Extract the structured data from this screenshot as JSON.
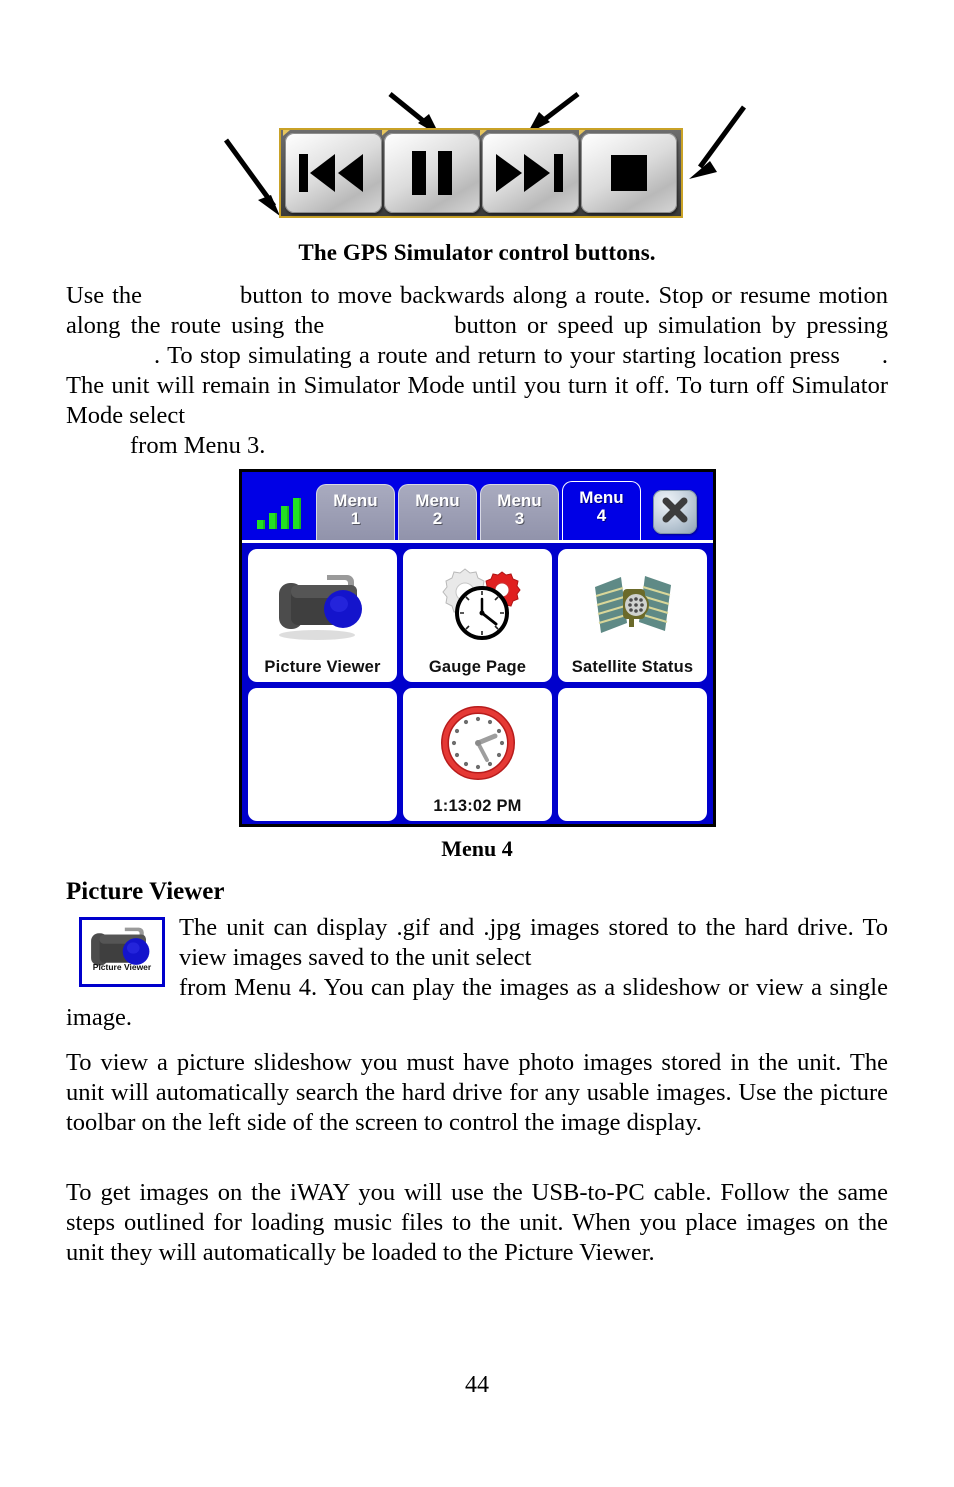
{
  "figure_buttons": {
    "caption": "The GPS Simulator control buttons.",
    "buttons": [
      {
        "name": "rewind",
        "icon": "skip-backward-icon"
      },
      {
        "name": "pause",
        "icon": "pause-icon"
      },
      {
        "name": "fast-forward",
        "icon": "skip-forward-icon"
      },
      {
        "name": "stop",
        "icon": "stop-icon"
      }
    ],
    "annotation_arrows": 4
  },
  "paragraphs": {
    "p1_seg1": "Use the",
    "p1_seg2": "button to move backwards along a route. Stop or resume motion along the route using the",
    "p1_seg3": "button or speed up simulation by pressing",
    "p1_seg4": ". To stop simulating a route and return to your starting location press",
    "p1_seg5": ". The unit will remain in Simulator Mode until you turn it off. To turn off Simulator Mode select",
    "p1_seg6": "from Menu 3.",
    "p3": "To view a picture slideshow you must have photo images stored in the unit. The unit will automatically search the hard drive for any usable images. Use the picture toolbar on the left side of the screen to control the image display.",
    "p4": "To get images on the iWAY you will use the USB-to-PC cable. Follow the same steps outlined for loading music files to the unit. When you place images on the unit they will automatically be loaded to the Picture Viewer."
  },
  "device": {
    "caption": "Menu 4",
    "signal_icon": "signal-strength-icon",
    "signal_bars": [
      9,
      16,
      23,
      31
    ],
    "signal_color": "#22e022",
    "background_color": "#0000cc",
    "tabbar_color": "#0000e6",
    "tabs": [
      {
        "line1": "Menu",
        "line2": "1",
        "active": false
      },
      {
        "line1": "Menu",
        "line2": "2",
        "active": false
      },
      {
        "line1": "Menu",
        "line2": "3",
        "active": false
      },
      {
        "line1": "Menu",
        "line2": "4",
        "active": true
      }
    ],
    "close_label": "close-icon",
    "cells": [
      {
        "label": "Picture  Viewer",
        "icon": "camera-icon",
        "empty": false
      },
      {
        "label": "Gauge Page",
        "icon": "gear-clock-icon",
        "empty": false
      },
      {
        "label": "Satellite  Status",
        "icon": "satellite-icon",
        "empty": false
      },
      {
        "label": "",
        "icon": "",
        "empty": true
      },
      {
        "label": "1:13:02 PM",
        "icon": "clock-icon",
        "empty": false
      },
      {
        "label": "",
        "icon": "",
        "empty": true
      }
    ]
  },
  "section": {
    "heading": "Picture Viewer",
    "thumb_label": "Picture Viewer",
    "thumb_icon": "camera-icon",
    "body_seg1": "The unit can display .gif and .jpg images stored to the hard drive. To view images saved to the unit select",
    "body_seg2": "from Menu 4. You can play the images as a slideshow or view a single image."
  },
  "footer": {
    "page_number": "44"
  }
}
